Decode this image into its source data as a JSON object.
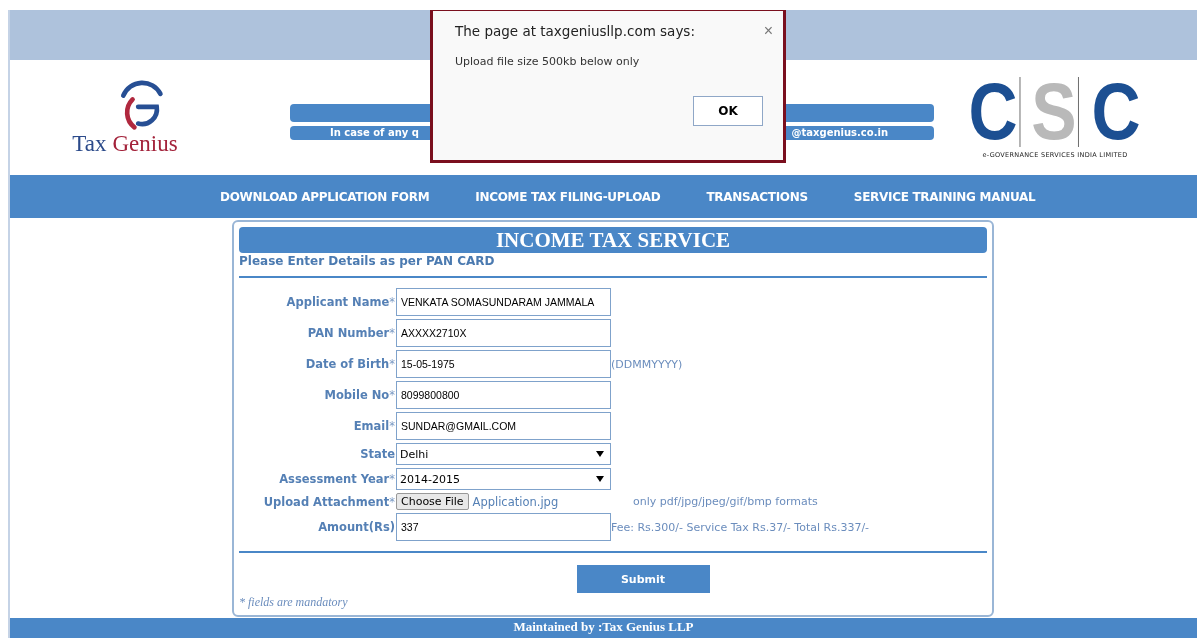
{
  "header": {
    "logo_words": [
      {
        "text": "Tax",
        "color": "#2b4a8a"
      },
      {
        "text": "Genius",
        "color": "#a3223a"
      }
    ],
    "contact_left": "In case of any q",
    "contact_right": "@taxgenius.co.in",
    "csc_letters": [
      {
        "text": "C",
        "color": "#1c4f92"
      },
      {
        "text": "S",
        "color": "#b9b9b9"
      },
      {
        "text": "C",
        "color": "#1c4f92"
      }
    ],
    "csc_tagline": "e-GOVERNANCE SERVICES INDIA LIMITED"
  },
  "nav": [
    "DOWNLOAD APPLICATION FORM",
    "INCOME TAX FILING-UPLOAD",
    "TRANSACTIONS",
    "SERVICE TRAINING MANUAL"
  ],
  "form": {
    "title": "INCOME TAX SERVICE",
    "subtitle": "Please Enter Details as per PAN CARD",
    "fields": [
      {
        "kind": "text",
        "label": "Applicant Name",
        "mark": "*",
        "value": "VENKATA SOMASUNDARAM JAMMALA"
      },
      {
        "kind": "text",
        "label": "PAN Number",
        "mark": "*",
        "value": "AXXXX2710X"
      },
      {
        "kind": "text",
        "label": "Date of Birth",
        "mark": "*",
        "value": "15-05-1975",
        "hint": "(DDMMYYYY)"
      },
      {
        "kind": "text",
        "label": "Mobile No",
        "mark": "*",
        "value": "8099800800"
      },
      {
        "kind": "text",
        "label": "Email",
        "mark": "*",
        "value": "SUNDAR@GMAIL.COM"
      },
      {
        "kind": "select",
        "label": "State",
        "value": "Delhi"
      },
      {
        "kind": "select",
        "label": "Assessment Year",
        "mark": "*",
        "value": "2014-2015"
      },
      {
        "kind": "file",
        "label": "Upload Attachment",
        "mark": "*",
        "button": "Choose File",
        "value": "Application.jpg",
        "hint": "only pdf/jpg/jpeg/gif/bmp formats"
      },
      {
        "kind": "text",
        "label": "Amount(Rs)",
        "value": "337",
        "hint": "Fee: Rs.300/- Service Tax Rs.37/- Total Rs.337/-"
      }
    ],
    "submit": "Submit",
    "note": "* fields are mandatory"
  },
  "footer": "Maintained by :Tax Genius LLP",
  "dialog": {
    "title": "The page at taxgeniusllp.com says:",
    "close": "×",
    "message": "Upload file size 500kb below only",
    "ok": "OK"
  }
}
